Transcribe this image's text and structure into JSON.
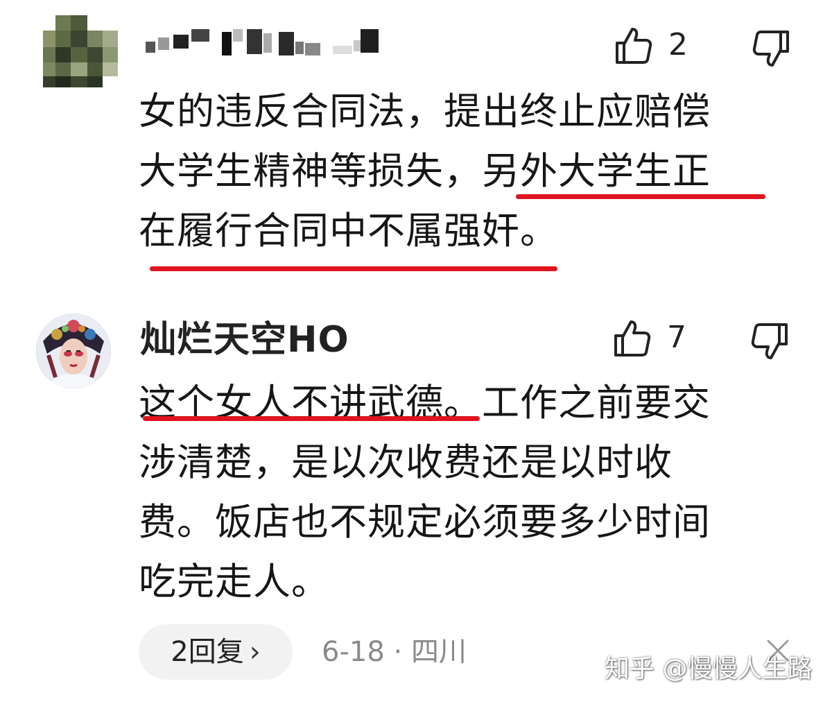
{
  "comments": [
    {
      "username": "",
      "likes": "2",
      "text_lines": [
        "女的违反合同法，提出终止应赔偿",
        "大学生精神等损失，另外大学生正",
        "在履行合同中不属强奸。"
      ],
      "underlined_text": "另外大学生正在履行合同中不属强奸",
      "icons": {
        "like": "thumbs-up-icon",
        "dislike": "thumbs-down-icon"
      }
    },
    {
      "username": "灿烂天空HO",
      "likes": "7",
      "text_lines": [
        "这个女人不讲武德。工作之前要交",
        "涉清楚，是以次收费还是以时收",
        "费。饭店也不规定必须要多少时间",
        "吃完走人。"
      ],
      "underlined_text": "这个女人不讲武德",
      "icons": {
        "like": "thumbs-up-icon",
        "dislike": "thumbs-down-icon"
      }
    }
  ],
  "footer": {
    "reply_label": "2回复",
    "reply_chevron": "›",
    "date": "6-18",
    "separator": "·",
    "location": "四川",
    "watermark": "知乎 @慢慢人生路"
  },
  "colors": {
    "underline": "#e0141e",
    "text": "#161616",
    "meta": "#8a8a8a",
    "pill_bg": "#f2f2f2"
  }
}
